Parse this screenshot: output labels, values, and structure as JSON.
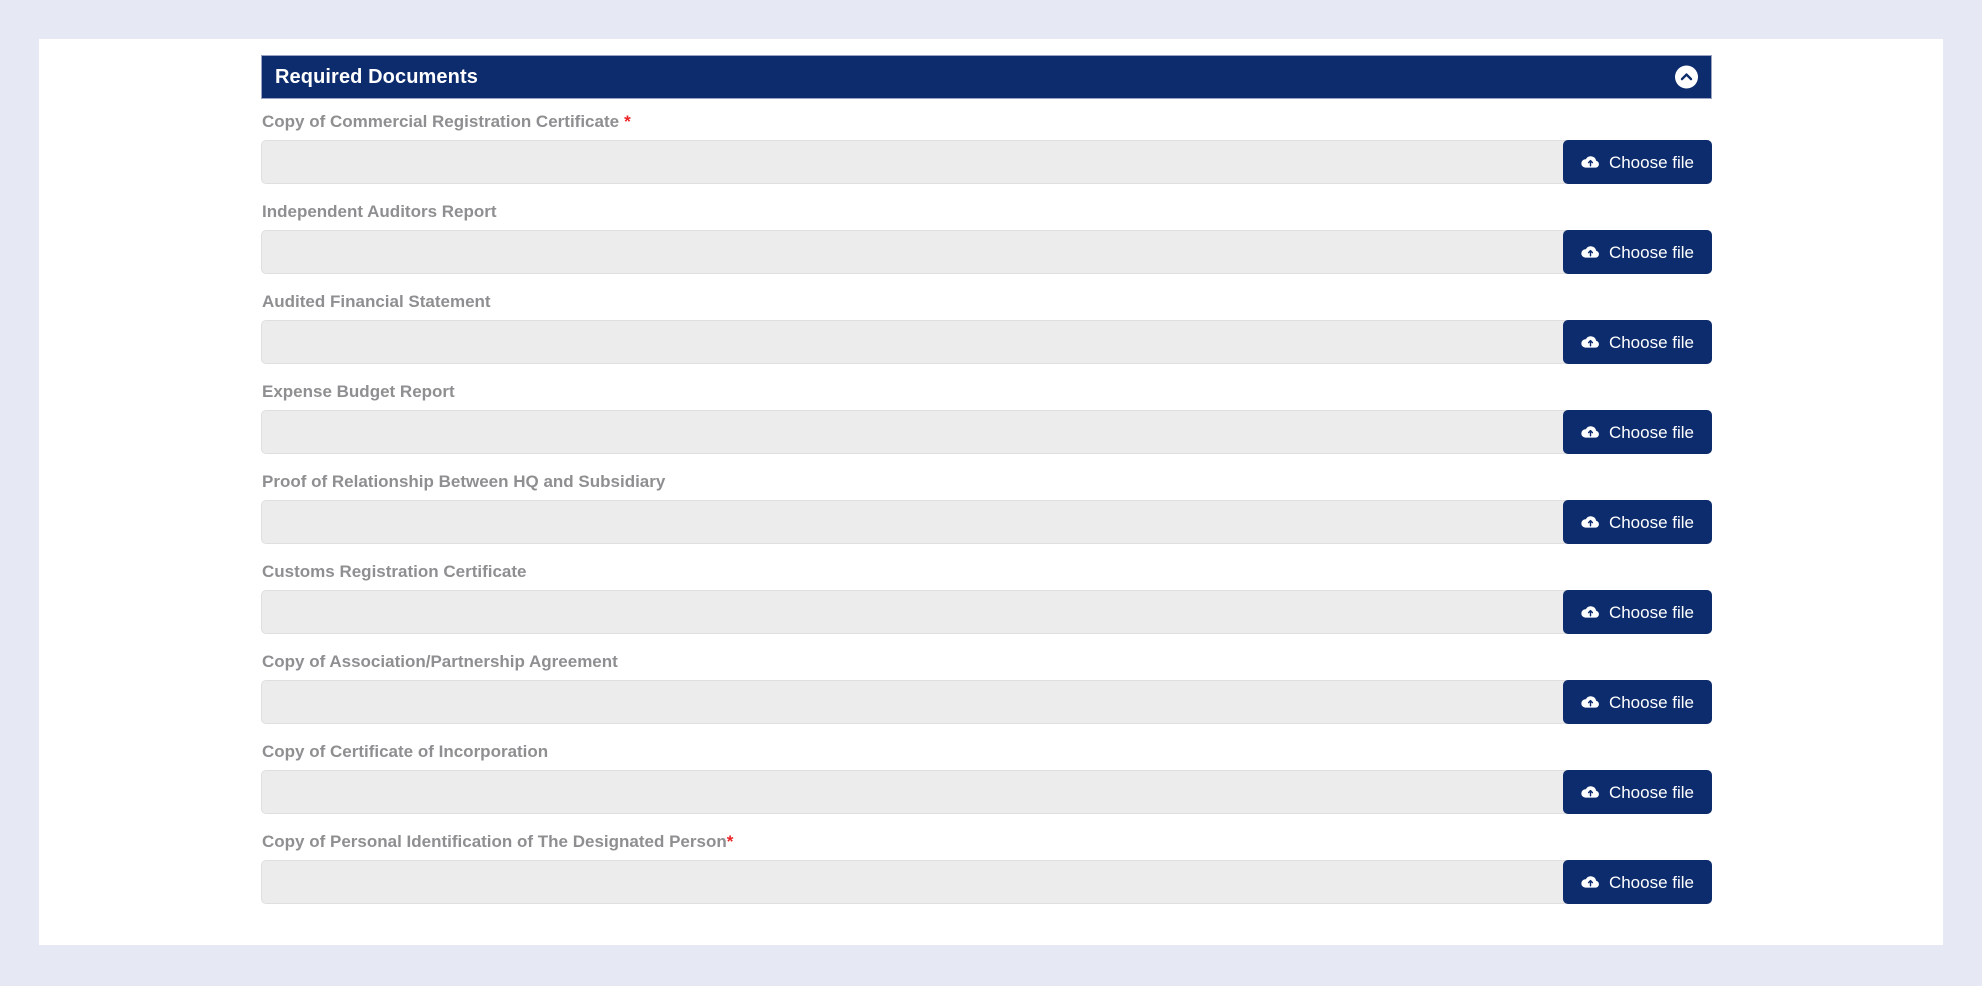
{
  "panel": {
    "title": "Required Documents",
    "collapse_icon": "chevron-up-icon",
    "header_color": "#0d2c6d",
    "accent_color": "#0d2c6d",
    "required_marker_color": "#ed2024",
    "label_color": "#8f8f91",
    "input_background": "#ececec",
    "page_background": "#e6e9f3",
    "card_background": "#ffffff"
  },
  "button": {
    "label": "Choose file",
    "icon": "cloud-upload-icon"
  },
  "documents": [
    {
      "label": "Copy of Commercial Registration Certificate",
      "required": true,
      "star": "*",
      "star_spaced": true,
      "value": "",
      "placeholder": ""
    },
    {
      "label": "Independent Auditors Report",
      "required": false,
      "star": "",
      "star_spaced": false,
      "value": "",
      "placeholder": ""
    },
    {
      "label": "Audited Financial Statement",
      "required": false,
      "star": "",
      "star_spaced": false,
      "value": "",
      "placeholder": ""
    },
    {
      "label": "Expense Budget Report",
      "required": false,
      "star": "",
      "star_spaced": false,
      "value": "",
      "placeholder": ""
    },
    {
      "label": "Proof of Relationship Between HQ and Subsidiary",
      "required": false,
      "star": "",
      "star_spaced": false,
      "value": "",
      "placeholder": ""
    },
    {
      "label": "Customs Registration Certificate",
      "required": false,
      "star": "",
      "star_spaced": false,
      "value": "",
      "placeholder": ""
    },
    {
      "label": "Copy of Association/Partnership Agreement",
      "required": false,
      "star": "",
      "star_spaced": false,
      "value": "",
      "placeholder": ""
    },
    {
      "label": "Copy of Certificate of Incorporation",
      "required": false,
      "star": "",
      "star_spaced": false,
      "value": "",
      "placeholder": ""
    },
    {
      "label": "Copy of Personal Identification of The Designated Person",
      "required": true,
      "star": "*",
      "star_spaced": false,
      "value": "",
      "placeholder": ""
    }
  ]
}
